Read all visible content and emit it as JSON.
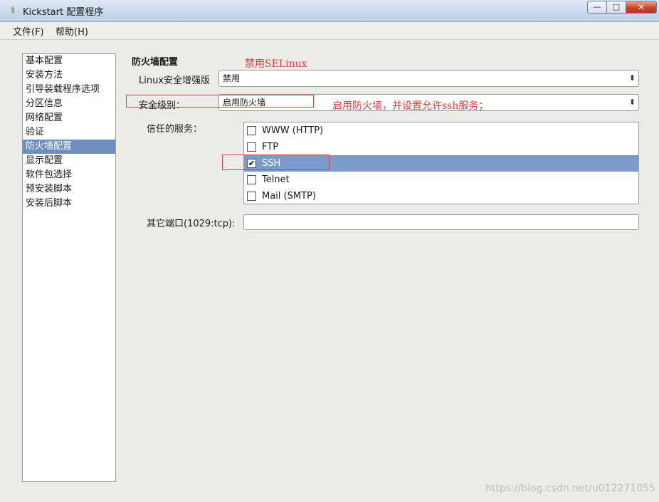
{
  "window": {
    "title": "Kickstart 配置程序",
    "icon": "kickstart-app-icon",
    "controls": {
      "minimize": "—",
      "maximize": "□",
      "close": "✕"
    }
  },
  "menubar": {
    "file": "文件(F)",
    "help": "帮助(H)"
  },
  "sidebar": {
    "items": [
      {
        "label": "基本配置"
      },
      {
        "label": "安装方法"
      },
      {
        "label": "引导装载程序选项"
      },
      {
        "label": "分区信息"
      },
      {
        "label": "网络配置"
      },
      {
        "label": "验证"
      },
      {
        "label": "防火墙配置"
      },
      {
        "label": "显示配置"
      },
      {
        "label": "软件包选择"
      },
      {
        "label": "预安装脚本"
      },
      {
        "label": "安装后脚本"
      }
    ],
    "selected_index": 6
  },
  "firewall": {
    "section_title": "防火墙配置",
    "selinux_label": "Linux安全增强版",
    "selinux_value": "禁用",
    "security_label": "安全级别：",
    "security_value": "启用防火墙",
    "trusted_label": "信任的服务：",
    "services": [
      {
        "label": "WWW (HTTP)",
        "checked": false
      },
      {
        "label": "FTP",
        "checked": false
      },
      {
        "label": "SSH",
        "checked": true
      },
      {
        "label": "Telnet",
        "checked": false
      },
      {
        "label": "Mail (SMTP)",
        "checked": false
      }
    ],
    "selected_service_index": 2,
    "other_ports_label": "其它端口(1029:tcp):",
    "other_ports_value": ""
  },
  "annotations": {
    "selinux_note": "禁用SELinux",
    "firewall_note": "启用防火墙，并设置允许ssh服务；",
    "color": "#e23a3a"
  },
  "watermark": "https://blog.csdn.net/u012271055",
  "colors": {
    "selection": "#6e8ebf",
    "titlebar": "#c9d9ec",
    "close_button": "#c7472d"
  }
}
